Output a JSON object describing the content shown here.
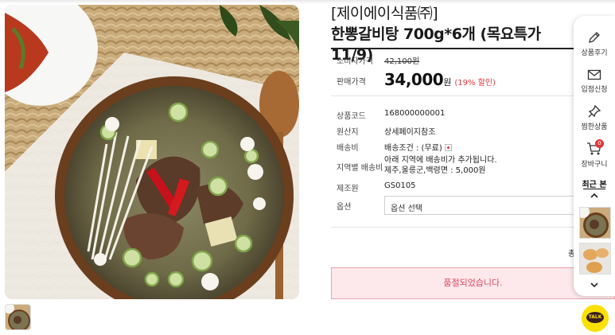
{
  "product": {
    "brand_line": "[제이에이식품㈜]",
    "name_line": "한뽕갈비탕 700g*6개 (목요특가 11/9)"
  },
  "price": {
    "consumer_label": "소비자가격",
    "consumer_value": "42,100원",
    "sale_label": "판매가격",
    "sale_value": "34,000",
    "sale_unit": "원",
    "discount": "(19% 할인)"
  },
  "info": [
    {
      "label": "상품코드",
      "value": "168000000001"
    },
    {
      "label": "원산지",
      "value": "상세페이지참조"
    },
    {
      "label": "배송비",
      "value": "배송조건 : (무료)"
    },
    {
      "label": "지역별 배송비",
      "value": "아래 지역에 배송비가 추가됩니다.",
      "value2": "제주,울릉군,백령면 : 5,000원"
    },
    {
      "label": "제조원",
      "value": "GS0105"
    }
  ],
  "option": {
    "label": "옵션",
    "selected": "옵션 선택"
  },
  "total_partial": "총",
  "sold_out": "품절되었습니다.",
  "side_panel": {
    "review": "상품후기",
    "store_apply": "입점신청",
    "wish": "찜한상품",
    "cart": "장바구니",
    "cart_count": "0",
    "recent": "최근 본"
  },
  "talk": "TALK",
  "colors": {
    "accent_red": "#e0383c",
    "sold_out_bg": "#fde9ec",
    "talk_yellow": "#f9e000"
  }
}
